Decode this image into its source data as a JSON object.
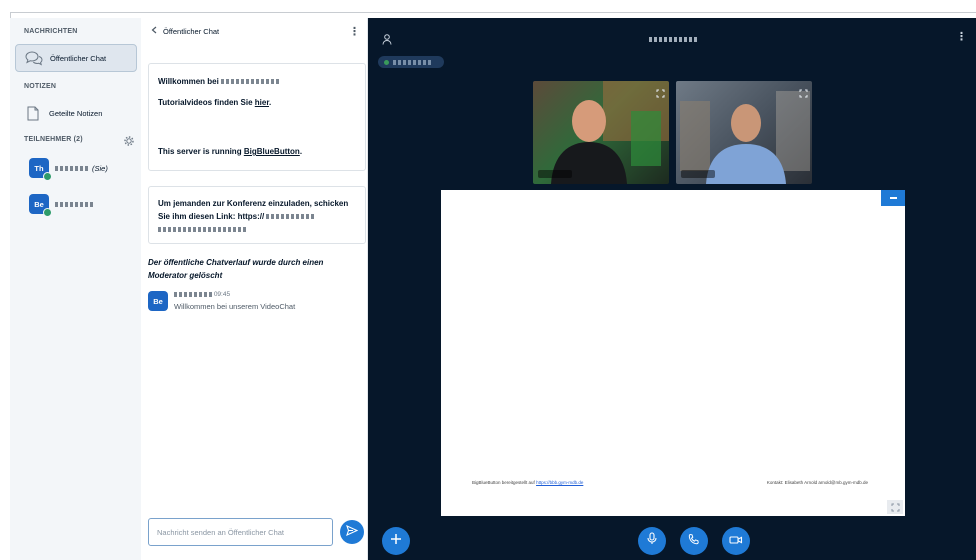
{
  "userlist": {
    "messages_heading": "NACHRICHTEN",
    "public_chat_label": "Öffentlicher Chat",
    "notes_heading": "NOTIZEN",
    "shared_notes_label": "Geteilte Notizen",
    "participants_heading": "TEILNEHMER (2)",
    "participants": [
      {
        "initials": "Th",
        "suffix": "(Sie)",
        "color": "#1d66c4"
      },
      {
        "initials": "Be",
        "suffix": "",
        "color": "#1d66c4"
      }
    ]
  },
  "chat": {
    "header_title": "Öffentlicher Chat",
    "welcome_prefix": "Willkommen bei",
    "tutorial_prefix": "Tutorialvideos finden Sie",
    "tutorial_link": "hier",
    "tutorial_suffix": ".",
    "server_prefix": "This server is running",
    "server_link": "BigBlueButton",
    "server_suffix": ".",
    "invite_text": "Um jemanden zur Konferenz einzuladen, schicken Sie ihm diesen Link: https://",
    "cleared_notice": "Der öffentliche Chatverlauf wurde durch einen Moderator gelöscht",
    "message": {
      "initials": "Be",
      "time": "09:45",
      "text": "Willkommen bei unserem VideoChat"
    },
    "composer_placeholder": "Nachricht senden an Öffentlicher Chat"
  },
  "presentation": {
    "footer_left_prefix": "BigBlueButton bereitgestellt auf",
    "footer_left_link": "https://bbb.gym-mdb.de",
    "footer_right": "Kontakt: Elisabeth Arnold arnold@mb.gym-mdb.de"
  },
  "icons": {
    "user": "user-icon",
    "chat": "chat-bubbles-icon",
    "notes": "document-icon",
    "settings": "gear-icon",
    "back": "chevron-left-icon",
    "send": "send-icon",
    "plus": "plus-icon",
    "mic": "microphone-icon",
    "phone": "phone-icon",
    "camera": "camera-icon",
    "expand": "expand-icon"
  },
  "colors": {
    "accent": "#1f7ad6",
    "main_bg": "#06172a",
    "status_green": "#2e9b6a"
  }
}
